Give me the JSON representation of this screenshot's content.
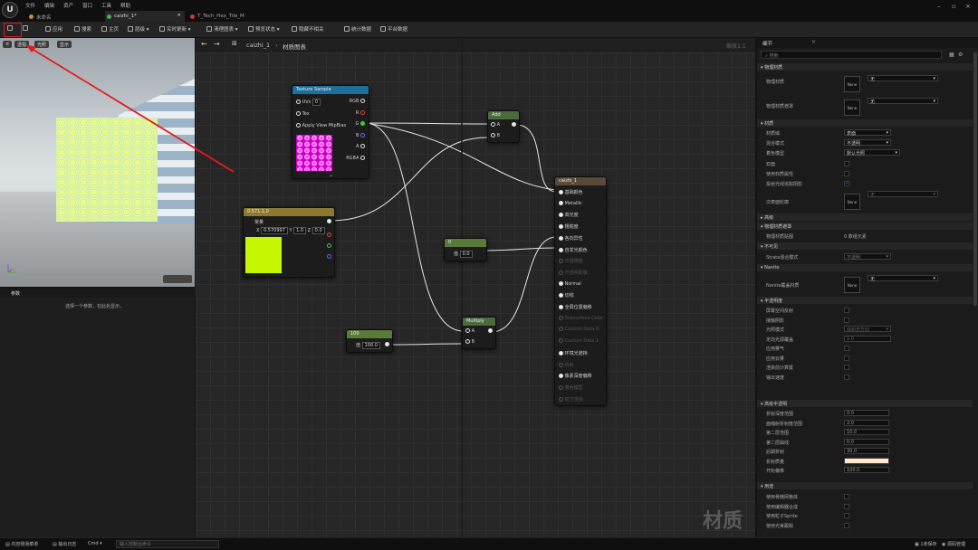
{
  "app": {
    "logo": "U",
    "menu": [
      "文件",
      "编辑",
      "资产",
      "窗口",
      "工具",
      "帮助"
    ]
  },
  "tabs": [
    {
      "label": "未命名",
      "icon": "level-icon",
      "color": "#d9892b"
    },
    {
      "label": "caizhi_1*",
      "icon": "material-icon",
      "color": "#49b04b"
    },
    {
      "label": "T_Tech_Hex_Tile_M",
      "icon": "texture-icon",
      "color": "#c43c3c"
    }
  ],
  "toolbar": {
    "apply": "应用",
    "search": "搜索",
    "home": "主页",
    "hierarchy": "层级",
    "live_update": "实时更新",
    "clean_graph": "清理图表",
    "preview_state": "预览状态",
    "hide_unrelated": "隐藏不相关",
    "stats": "统计数据",
    "platform_stats": "平台数据"
  },
  "viewport": {
    "btn_lit": "透视",
    "btn_shading": "光照",
    "btn_show": "显示"
  },
  "params": {
    "tab": "参数",
    "hint": "选择一个参数，在此处显示。"
  },
  "graph": {
    "breadcrumb_root": "caizhi_1",
    "breadcrumb_leaf": "材质图表",
    "zoom": "缩放1:1",
    "watermark": "材质"
  },
  "nodes": {
    "texture": {
      "title": "Texture Sample",
      "in": [
        "UVs",
        "Tex",
        "Apply View MipBias"
      ],
      "uv_val": "0",
      "out": [
        "RGB",
        "R",
        "G",
        "B",
        "A",
        "RGBA"
      ]
    },
    "add": {
      "title": "Add",
      "in": [
        "A",
        "B"
      ]
    },
    "const3": {
      "title": "0.571,1,0",
      "label": "常量",
      "x": "0.570997",
      "y": "1.0",
      "z": "0.0",
      "color": "#c5f700"
    },
    "const_zero": {
      "title": "0",
      "label": "值",
      "val": "0.0"
    },
    "const100": {
      "title": "100",
      "label": "值",
      "val": "100.0"
    },
    "multiply": {
      "title": "Multiply",
      "in": [
        "A",
        "B"
      ]
    },
    "main": {
      "title": "caizhi_1",
      "pins": [
        {
          "label": "基础颜色",
          "on": true
        },
        {
          "label": "Metallic",
          "on": true
        },
        {
          "label": "高光度",
          "on": true
        },
        {
          "label": "粗糙度",
          "on": true
        },
        {
          "label": "各向异性",
          "on": true
        },
        {
          "label": "自发光颜色",
          "on": true
        },
        {
          "label": "不透明度",
          "on": false
        },
        {
          "label": "不透明蒙版",
          "on": false
        },
        {
          "label": "Normal",
          "on": true
        },
        {
          "label": "切线",
          "on": true
        },
        {
          "label": "全局位置偏移",
          "on": true
        },
        {
          "label": "Subsurface Color",
          "on": false
        },
        {
          "label": "Custom Data 0",
          "on": false
        },
        {
          "label": "Custom Data 1",
          "on": false
        },
        {
          "label": "环境光遮挡",
          "on": true
        },
        {
          "label": "折射",
          "on": false
        },
        {
          "label": "像素深度偏移",
          "on": true
        },
        {
          "label": "着色模型",
          "on": false
        },
        {
          "label": "前方渲染",
          "on": false
        }
      ]
    }
  },
  "details": {
    "tab": "细节",
    "search_placeholder": "搜索",
    "sections": {
      "phys": "物理材质",
      "material": "材质",
      "advanced": "高级",
      "phys_mask": "物理材质遮罩",
      "nonsub": "不可见",
      "nanite": "Nanite",
      "translucency": "半透明度",
      "refraction": "高级半透明",
      "usage": "用途"
    },
    "phys": {
      "l1": "物理材质",
      "l2": "物理材质遮罩",
      "v": "无",
      "none": "None"
    },
    "mat": {
      "domain_l": "材质域",
      "domain_v": "表面",
      "blend_l": "混合模式",
      "blend_v": "不透明",
      "shading_l": "着色模型",
      "shading_v": "默认光照",
      "two_sided": "双面",
      "use_mat_attr": "使用材质属性",
      "cast_ray": "投射光线追踪阴影",
      "sub_l": "次表面轮廓",
      "sub_v": "无",
      "none": "None"
    },
    "phys_map_l": "物理材质贴图",
    "phys_map_v": "0 数组元素",
    "strata_l": "Strata混合模式",
    "strata_v": "不透明",
    "nanite_l": "Nanite覆盖材质",
    "nanite_v": "无",
    "nanite_none": "None",
    "trans": [
      "屏幕空间反射",
      "接触阴影",
      "光照模式",
      "定向光源覆盖",
      "应用雾气",
      "应用云雾",
      "渲染前计算置",
      "输出速度"
    ],
    "trans_mode": "体积无方向",
    "trans_val": "1.0",
    "refr": [
      "折射深度范围",
      "面缩射折射度范围",
      "第二层范围",
      "第二层曲线",
      "后期折射",
      "折射质量",
      "开始偏移"
    ],
    "refr_vals": [
      "0.0",
      "2.0",
      "10.0",
      "0.0",
      "30.0",
      "",
      "100.0"
    ],
    "refr_color": "#ffe8cc",
    "usage": [
      "使用骨骼网格体",
      "使用编辑器合成",
      "使用粒子Sprite",
      "使用光束跟踪"
    ]
  },
  "statusbar": {
    "drawer": "内容侧滑菜单",
    "log": "输出日志",
    "cmd": "Cmd",
    "cmd_placeholder": "输入控制台命令",
    "unsaved": "1未保存",
    "source": "源码管理"
  }
}
